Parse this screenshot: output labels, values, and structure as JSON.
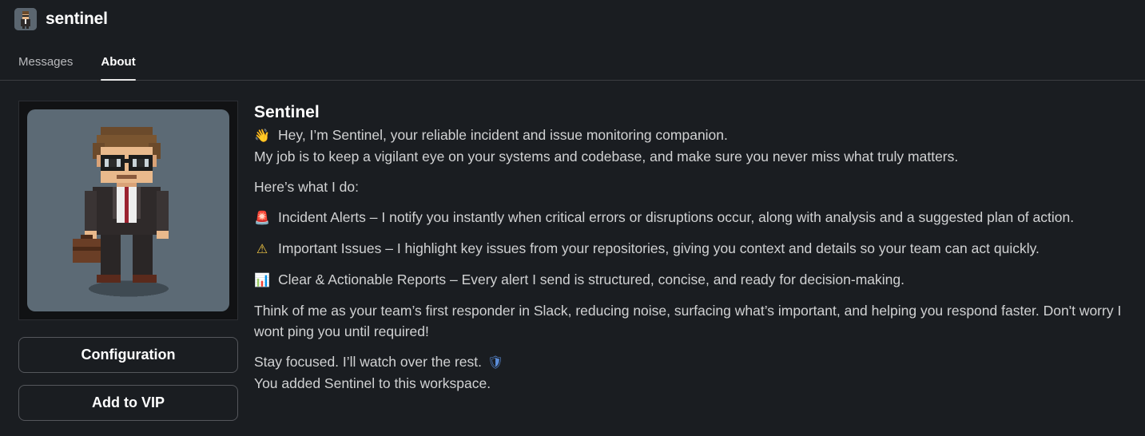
{
  "app": {
    "name": "sentinel"
  },
  "tabs": [
    {
      "label": "Messages",
      "active": false
    },
    {
      "label": "About",
      "active": true
    }
  ],
  "buttons": {
    "configuration": "Configuration",
    "add_vip": "Add to VIP"
  },
  "about": {
    "title": "Sentinel",
    "intro_line1": "Hey, I’m Sentinel, your reliable incident and issue monitoring companion.",
    "intro_line2": "My job is to keep a vigilant eye on your systems and codebase, and make sure you never miss what truly matters.",
    "heading": "Here’s what I do:",
    "items": [
      {
        "icon": "rotating-light-icon",
        "glyph": "🚨",
        "text": "Incident Alerts – I notify you instantly when critical errors or disruptions occur, along with analysis and a suggested plan of action."
      },
      {
        "icon": "warning-icon",
        "glyph": "⚠",
        "text": "Important Issues – I highlight key issues from your repositories, giving you context and details so your team can act quickly."
      },
      {
        "icon": "bar-chart-icon",
        "glyph": "📊",
        "text": "Clear & Actionable Reports – Every alert I send is structured, concise, and ready for decision-making."
      }
    ],
    "summary": "Think of me as your team’s first responder in Slack, reducing noise, surfacing what’s important, and helping you respond faster. Don't worry I wont ping you until required!",
    "closing": "Stay focused. I’ll watch over the rest.",
    "added_note": "You added Sentinel to this workspace."
  },
  "colors": {
    "background": "#1a1d21",
    "text": "#d1d2d3",
    "heading": "#ffffff",
    "border": "#55575c"
  }
}
